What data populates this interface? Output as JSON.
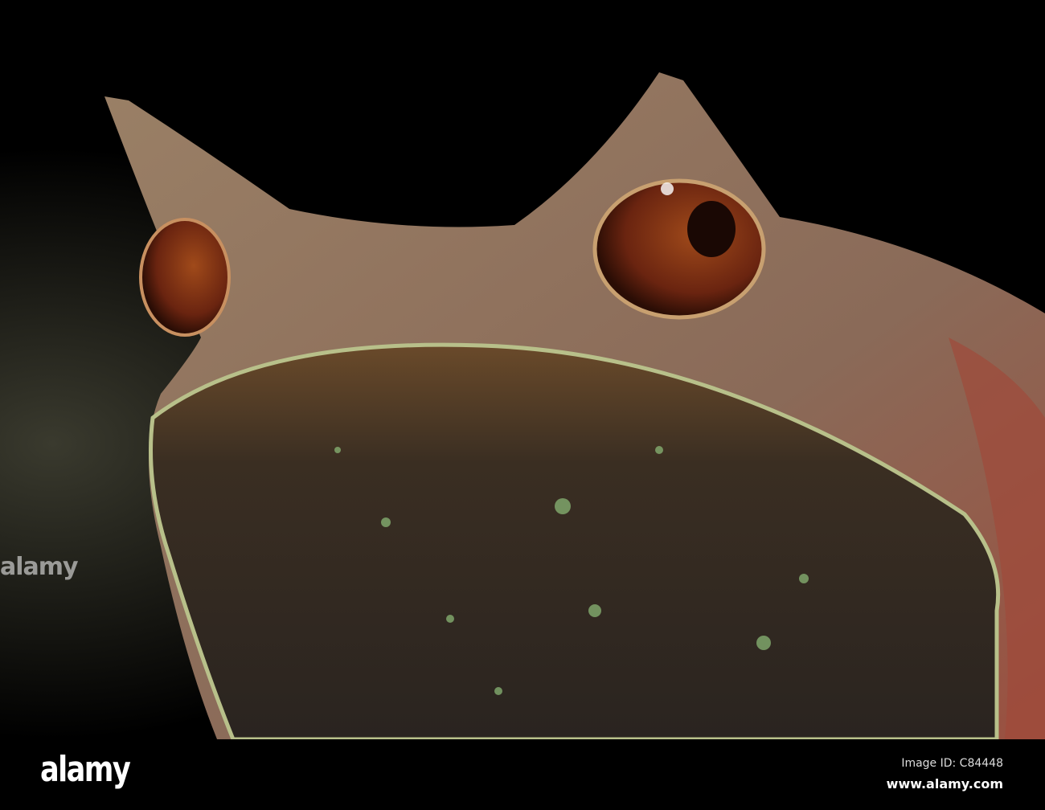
{
  "photo": {
    "subject": "horned frog close-up"
  },
  "watermark": {
    "text": "alamy"
  },
  "footer": {
    "logo": "alamy",
    "image_id": "Image ID: C84448",
    "url": "www.alamy.com"
  }
}
